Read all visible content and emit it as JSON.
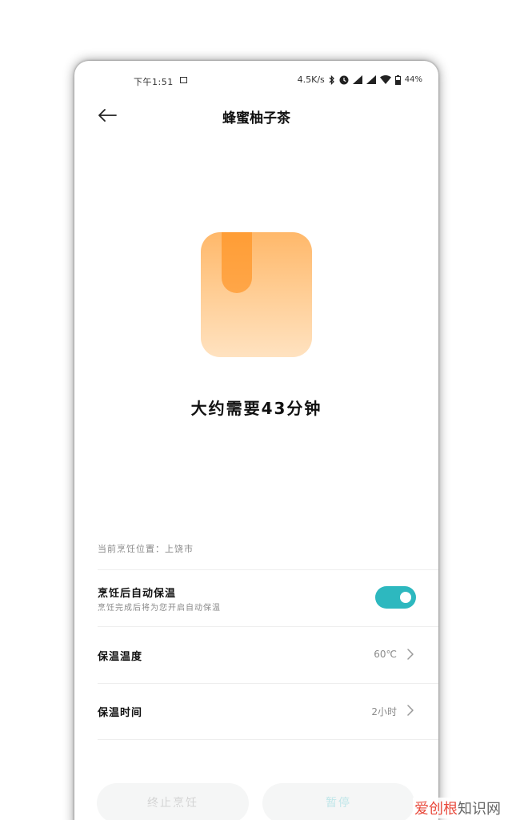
{
  "status_bar": {
    "time": "下午1:51",
    "speed": "4.5K/s",
    "battery": "44%"
  },
  "header": {
    "title": "蜂蜜柚子茶"
  },
  "main": {
    "duration": "大约需要43分钟",
    "location": "当前烹饪位置：上饶市"
  },
  "settings": {
    "auto_keep_warm": {
      "title": "烹饪后自动保温",
      "subtitle": "烹饪完成后将为您开启自动保温",
      "enabled": true
    },
    "keep_warm_temp": {
      "label": "保温温度",
      "value": "60℃"
    },
    "keep_warm_time": {
      "label": "保温时间",
      "value": "2小时"
    }
  },
  "actions": {
    "stop_label": "终止烹饪",
    "pause_label": "暂停"
  },
  "watermark": {
    "text_accent": "爱创根",
    "text_rest": "知识网"
  },
  "colors": {
    "accent": "#2db8bf",
    "illustration_orange": "#ff9c33"
  }
}
